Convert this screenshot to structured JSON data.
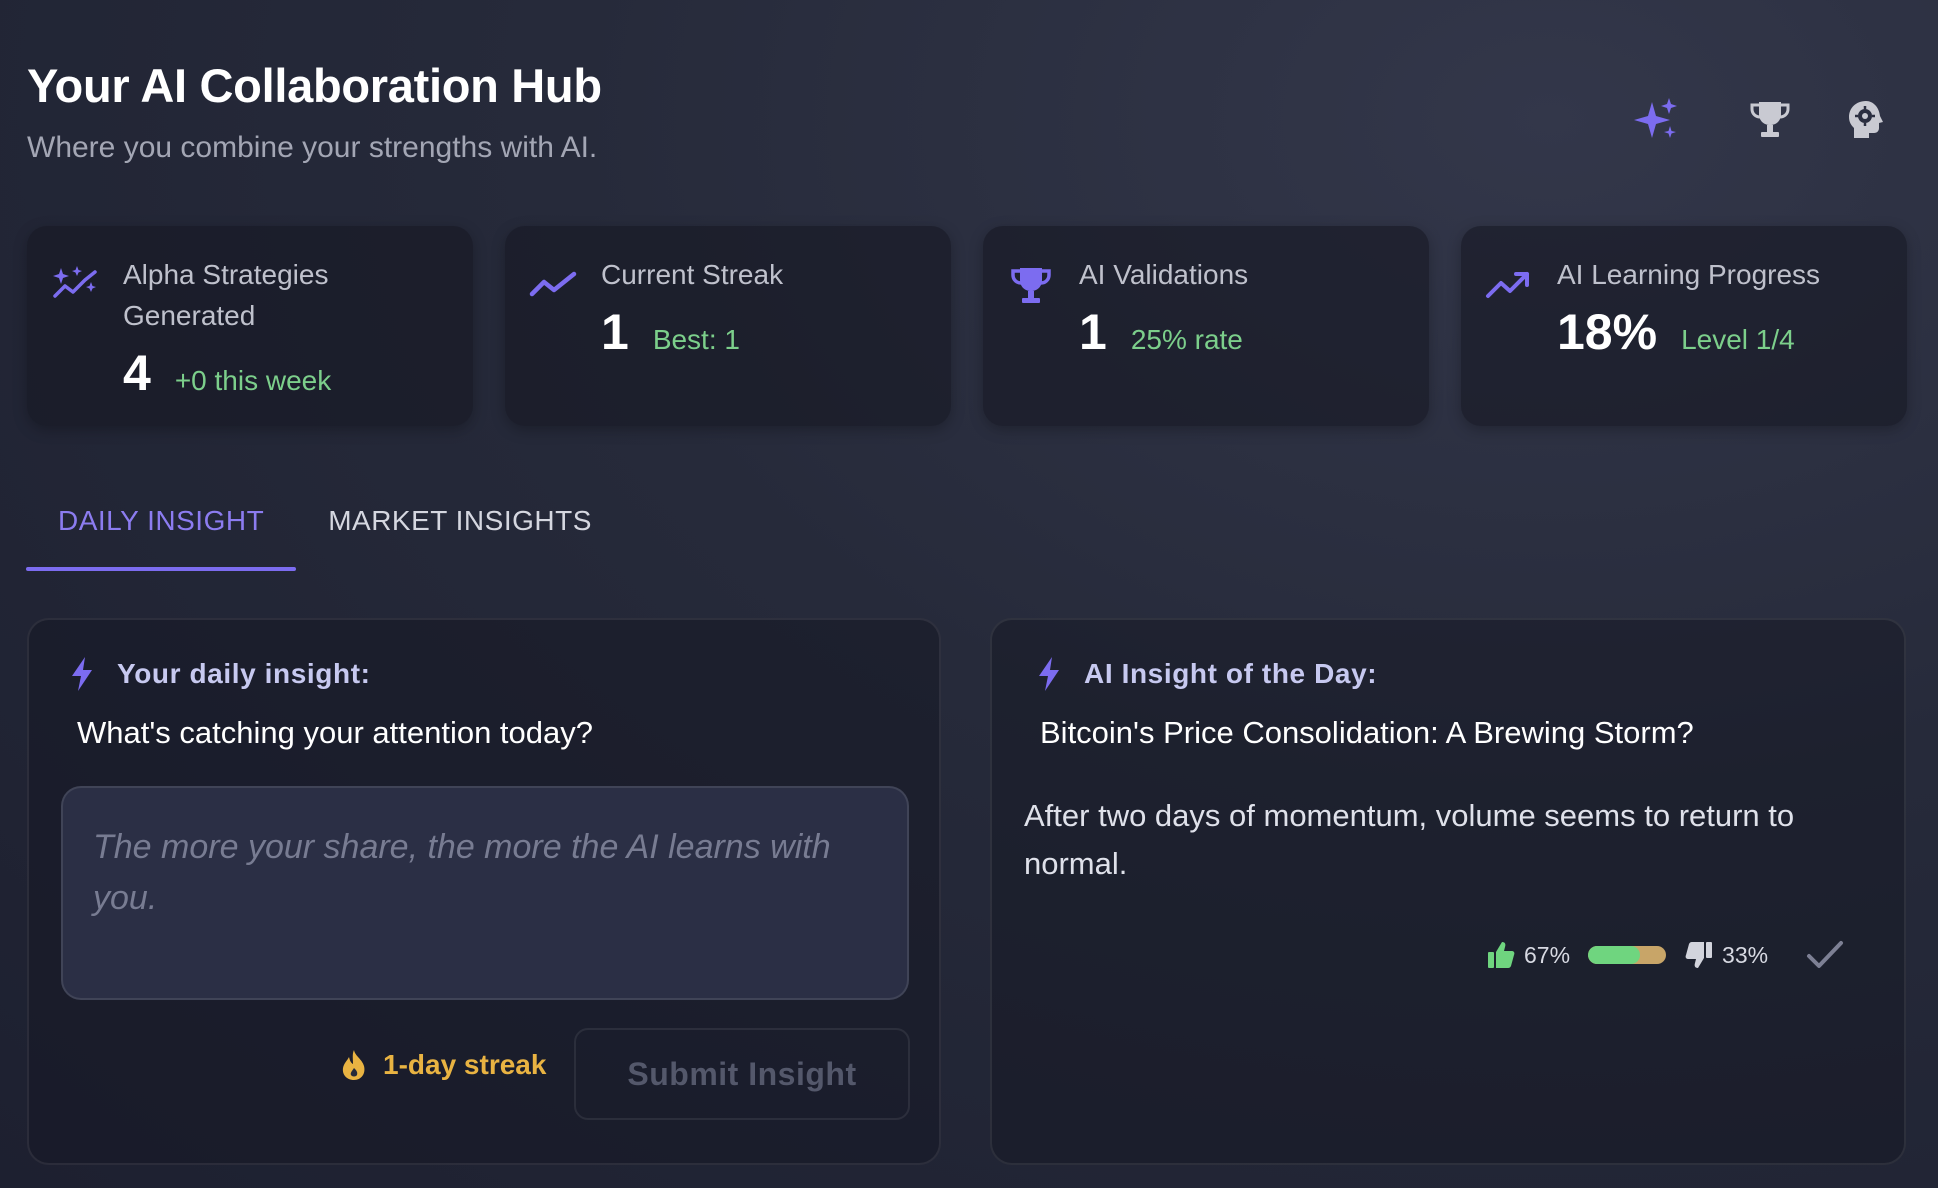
{
  "header": {
    "title": "Your AI Collaboration Hub",
    "subtitle": "Where you combine your strengths with AI.",
    "icons": [
      "sparkles-icon",
      "trophy-icon",
      "brain-gear-icon"
    ]
  },
  "stats": [
    {
      "icon": "sparkles-line-icon",
      "label": "Alpha Strategies Generated",
      "value": "4",
      "sub": "+0 this week"
    },
    {
      "icon": "trend-line-icon",
      "label": "Current Streak",
      "value": "1",
      "sub": "Best: 1"
    },
    {
      "icon": "trophy-icon",
      "label": "AI Validations",
      "value": "1",
      "sub": "25% rate"
    },
    {
      "icon": "trending-up-icon",
      "label": "AI Learning Progress",
      "value": "18%",
      "sub": "Level 1/4"
    }
  ],
  "tabs": [
    {
      "label": "DAILY INSIGHT",
      "active": true
    },
    {
      "label": "MARKET INSIGHTS",
      "active": false
    }
  ],
  "daily": {
    "heading": "Your daily insight:",
    "question": "What's catching your attention today?",
    "placeholder": "The more your share, the more the AI learns with you.",
    "streak": "1-day streak",
    "submit": "Submit Insight"
  },
  "ai": {
    "heading": "AI Insight of the Day:",
    "title": "Bitcoin's Price Consolidation: A Brewing Storm?",
    "body": "After two days of momentum, volume seems to return to normal.",
    "up_pct": "67%",
    "down_pct": "33%",
    "up_fraction": 0.67
  },
  "colors": {
    "accent": "#7c6cf0",
    "positive": "#7ccf8b",
    "streak": "#e9b342",
    "negative_bar": "#c8a568"
  }
}
